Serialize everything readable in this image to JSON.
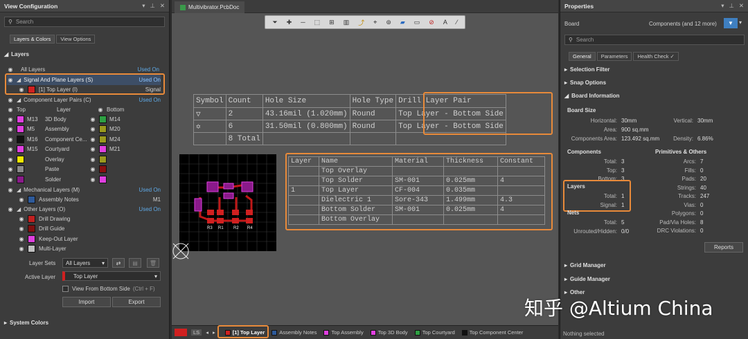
{
  "left": {
    "title": "View Configuration",
    "search_placeholder": "Search",
    "tabs": [
      "Layers & Colors",
      "View Options"
    ],
    "layers_header": "Layers",
    "all_layers": "All Layers",
    "used_on": "Used On",
    "signal_group": "Signal And Plane Layers (S)",
    "top_layer": "[1] Top Layer (I)",
    "signal": "Signal",
    "comp_pairs": "Component Layer Pairs (C)",
    "col_top": "Top",
    "col_layer": "Layer",
    "col_bottom": "Bottom",
    "pairs": [
      {
        "l": "M13",
        "name": "3D Body",
        "r": "M14",
        "lc": "#e040e0",
        "rc": "#2ea043"
      },
      {
        "l": "M5",
        "name": "Assembly",
        "r": "M20",
        "lc": "#e040e0",
        "rc": "#9a9a1e"
      },
      {
        "l": "M16",
        "name": "Component Ce...",
        "r": "M24",
        "lc": "#111111",
        "rc": "#9a9a1e"
      },
      {
        "l": "M15",
        "name": "Courtyard",
        "r": "M21",
        "lc": "#e040e0",
        "rc": "#e040e0"
      },
      {
        "l": "",
        "name": "Overlay",
        "r": "",
        "lc": "#f0e800",
        "rc": "#9a9a1e"
      },
      {
        "l": "",
        "name": "Paste",
        "r": "",
        "lc": "#8a8a8a",
        "rc": "#8a1010"
      },
      {
        "l": "",
        "name": "Solder",
        "r": "",
        "lc": "#8a1a8a",
        "rc": "#e040e0"
      }
    ],
    "mech_group": "Mechanical Layers (M)",
    "assembly_notes": "Assembly Notes",
    "m1": "M1",
    "other_group": "Other Layers (O)",
    "others": [
      {
        "name": "Drill Drawing",
        "c": "#c02020"
      },
      {
        "name": "Drill Guide",
        "c": "#801010"
      },
      {
        "name": "Keep-Out Layer",
        "c": "#e040e0"
      },
      {
        "name": "Multi-Layer",
        "c": "#c0c0c0"
      }
    ],
    "layer_sets_label": "Layer Sets",
    "layer_sets_value": "All Layers",
    "active_layer_label": "Active Layer",
    "active_layer_value": "Top Layer",
    "view_bottom": "View From Bottom Side",
    "view_bottom_shortcut": "(Ctrl + F)",
    "import": "Import",
    "export": "Export",
    "system_colors": "System Colors"
  },
  "center": {
    "doc_tab": "Multivibrator.PcbDoc",
    "drill_table": {
      "headers": [
        "Symbol",
        "Count",
        "Hole Size",
        "Hole Type",
        "Drill Layer Pair"
      ],
      "rows": [
        [
          "▽",
          "2",
          "43.16mil (1.020mm)",
          "Round",
          "Top Layer - Bottom Side"
        ],
        [
          "✡",
          "6",
          "31.50mil (0.800mm)",
          "Round",
          "Top Layer - Bottom Side"
        ],
        [
          "",
          "8 Total",
          "",
          "",
          ""
        ]
      ]
    },
    "stack_table": {
      "headers": [
        "Layer",
        "Name",
        "Material",
        "Thickness",
        "Constant"
      ],
      "rows": [
        [
          "",
          "Top Overlay",
          "",
          "",
          ""
        ],
        [
          "",
          "Top Solder",
          "SM-001",
          "0.025mm",
          "4"
        ],
        [
          "1",
          "Top Layer",
          "CF-004",
          "0.035mm",
          ""
        ],
        [
          "",
          "Dielectric 1",
          "Sore-343",
          "1.499mm",
          "4.3"
        ],
        [
          "",
          "Bottom Solder",
          "SM-001",
          "0.025mm",
          "4"
        ],
        [
          "",
          "Bottom Overlay",
          "",
          "",
          ""
        ]
      ]
    },
    "pcb_labels": [
      "R3",
      "R1",
      "R2",
      "R4"
    ],
    "bottom_layers": [
      {
        "name": "LS",
        "c": ""
      },
      {
        "name": "[1] Top Layer",
        "c": "#d02020"
      },
      {
        "name": "Assembly Notes",
        "c": "#2e5a9a"
      },
      {
        "name": "Top Assembly",
        "c": "#e040e0"
      },
      {
        "name": "Top 3D Body",
        "c": "#e040e0"
      },
      {
        "name": "Top Courtyard",
        "c": "#2ea043"
      },
      {
        "name": "Top Component Center",
        "c": "#111111"
      }
    ]
  },
  "right": {
    "title": "Properties",
    "board": "Board",
    "components_more": "Components (and 12 more)",
    "search_placeholder": "Search",
    "tabs": [
      "General",
      "Parameters",
      "Health Check ✓"
    ],
    "sections": [
      "Selection Filter",
      "Snap Options",
      "Board Information"
    ],
    "board_size": "Board Size",
    "horizontal_k": "Horizontal:",
    "horizontal_v": "30mm",
    "vertical_k": "Vertical:",
    "vertical_v": "30mm",
    "area_k": "Area:",
    "area_v": "900 sq.mm",
    "comp_area_k": "Components Area:",
    "comp_area_v": "123.492 sq.mm",
    "density_k": "Density:",
    "density_v": "6.86%",
    "components": "Components",
    "prims": "Primitives & Others",
    "comp_rows": [
      [
        "Total:",
        "3"
      ],
      [
        "Top:",
        "3"
      ],
      [
        "Bottom:",
        "3"
      ]
    ],
    "prim_rows": [
      [
        "Arcs:",
        "7"
      ],
      [
        "Fills:",
        "0"
      ],
      [
        "Pads:",
        "20"
      ],
      [
        "Strings:",
        "40"
      ],
      [
        "Tracks:",
        "247"
      ],
      [
        "Vias:",
        "0"
      ],
      [
        "Polygons:",
        "0"
      ],
      [
        "Pad/Via Holes:",
        "8"
      ],
      [
        "DRC Violations:",
        "0"
      ]
    ],
    "layers": "Layers",
    "layer_rows": [
      [
        "Total:",
        "1"
      ],
      [
        "Signal:",
        "1"
      ]
    ],
    "nets": "Nets",
    "net_rows": [
      [
        "Total:",
        "5"
      ],
      [
        "Unrouted/Hidden:",
        "0/0"
      ]
    ],
    "reports": "Reports",
    "bottom_sections": [
      "Grid Manager",
      "Guide Manager",
      "Other"
    ],
    "status": "Nothing selected"
  },
  "watermark": "知乎 @Altium China",
  "accent": "#e88a3a"
}
